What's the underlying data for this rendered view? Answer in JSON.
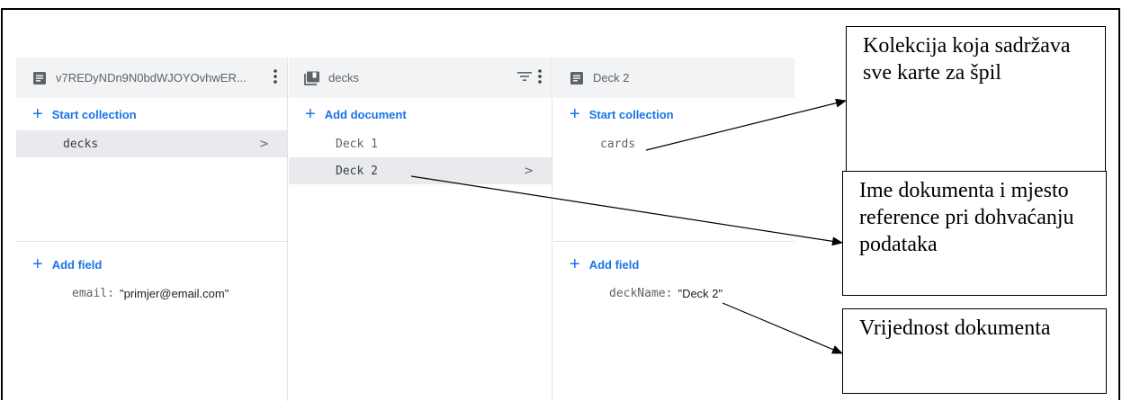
{
  "panels": [
    {
      "header": {
        "title": "v7REDyNDn9N0bdWJOYOvhwER...",
        "icon": "document-icon"
      },
      "add_action": {
        "label": "Start collection"
      },
      "items": [
        {
          "label": "decks",
          "selected": true
        }
      ],
      "add_field": {
        "label": "Add field"
      },
      "fields": [
        {
          "key": "email:",
          "value": "\"primjer@email.com\""
        }
      ]
    },
    {
      "header": {
        "title": "decks",
        "icon": "collection-icon"
      },
      "add_action": {
        "label": "Add document"
      },
      "items": [
        {
          "label": "Deck 1",
          "selected": false
        },
        {
          "label": "Deck 2",
          "selected": true
        }
      ]
    },
    {
      "header": {
        "title": "Deck 2",
        "icon": "document-icon"
      },
      "add_action": {
        "label": "Start collection"
      },
      "items": [
        {
          "label": "cards",
          "selected": false
        }
      ],
      "add_field": {
        "label": "Add field"
      },
      "fields": [
        {
          "key": "deckName:",
          "value": "\"Deck 2\""
        }
      ]
    }
  ],
  "annotations": [
    {
      "text": "Kolekcija koja sadržava sve karte za špil"
    },
    {
      "text": "Ime dokumenta i mjesto reference pri dohvaćanju podataka"
    },
    {
      "text": "Vrijednost dokumenta"
    }
  ],
  "colors": {
    "accent": "#1a73e8",
    "header_bg": "#f1f3f4",
    "selected_bg": "#e8eaed"
  }
}
